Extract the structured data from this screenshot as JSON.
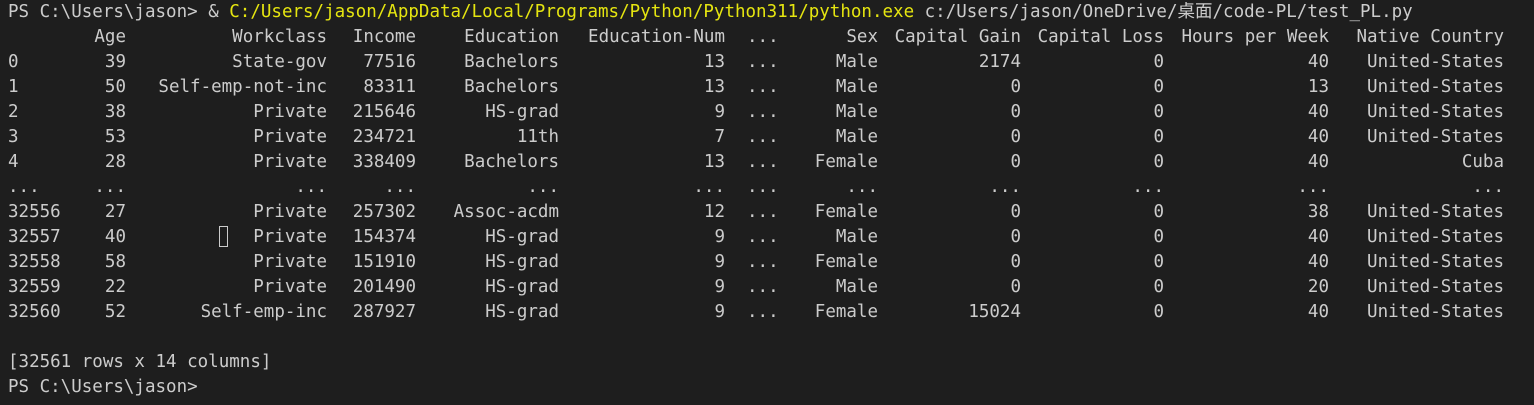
{
  "command": {
    "prompt": "PS C:\\Users\\jason> ",
    "operator": "& ",
    "executable": "C:/Users/jason/AppData/Local/Programs/Python/Python311/python.exe",
    "script": " c:/Users/jason/OneDrive/桌面/code-PL/test_PL.py"
  },
  "table": {
    "columns": [
      "",
      "Age",
      "Workclass",
      "Income",
      "Education",
      "Education-Num",
      "...",
      "Sex",
      "Capital Gain",
      "Capital Loss",
      "Hours per Week",
      "Native Country"
    ],
    "rows": [
      [
        "0",
        "39",
        "State-gov",
        "77516",
        "Bachelors",
        "13",
        "...",
        "Male",
        "2174",
        "0",
        "40",
        "United-States"
      ],
      [
        "1",
        "50",
        "Self-emp-not-inc",
        "83311",
        "Bachelors",
        "13",
        "...",
        "Male",
        "0",
        "0",
        "13",
        "United-States"
      ],
      [
        "2",
        "38",
        "Private",
        "215646",
        "HS-grad",
        "9",
        "...",
        "Male",
        "0",
        "0",
        "40",
        "United-States"
      ],
      [
        "3",
        "53",
        "Private",
        "234721",
        "11th",
        "7",
        "...",
        "Male",
        "0",
        "0",
        "40",
        "United-States"
      ],
      [
        "4",
        "28",
        "Private",
        "338409",
        "Bachelors",
        "13",
        "...",
        "Female",
        "0",
        "0",
        "40",
        "Cuba"
      ],
      [
        "...",
        "...",
        "...",
        "...",
        "...",
        "...",
        "...",
        "...",
        "...",
        "...",
        "...",
        "..."
      ],
      [
        "32556",
        "27",
        "Private",
        "257302",
        "Assoc-acdm",
        "12",
        "...",
        "Female",
        "0",
        "0",
        "38",
        "United-States"
      ],
      [
        "32557",
        "40",
        "Private",
        "154374",
        "HS-grad",
        "9",
        "...",
        "Male",
        "0",
        "0",
        "40",
        "United-States"
      ],
      [
        "32558",
        "58",
        "Private",
        "151910",
        "HS-grad",
        "9",
        "...",
        "Female",
        "0",
        "0",
        "40",
        "United-States"
      ],
      [
        "32559",
        "22",
        "Private",
        "201490",
        "HS-grad",
        "9",
        "...",
        "Male",
        "0",
        "0",
        "20",
        "United-States"
      ],
      [
        "32560",
        "52",
        "Self-emp-inc",
        "287927",
        "HS-grad",
        "9",
        "...",
        "Female",
        "15024",
        "0",
        "40",
        "United-States"
      ]
    ]
  },
  "summary": "[32561 rows x 14 columns]",
  "final_prompt": "PS C:\\Users\\jason>",
  "colors": {
    "background": "#1e1e1e",
    "text": "#cccccc",
    "path_highlight": "#e5e510"
  }
}
